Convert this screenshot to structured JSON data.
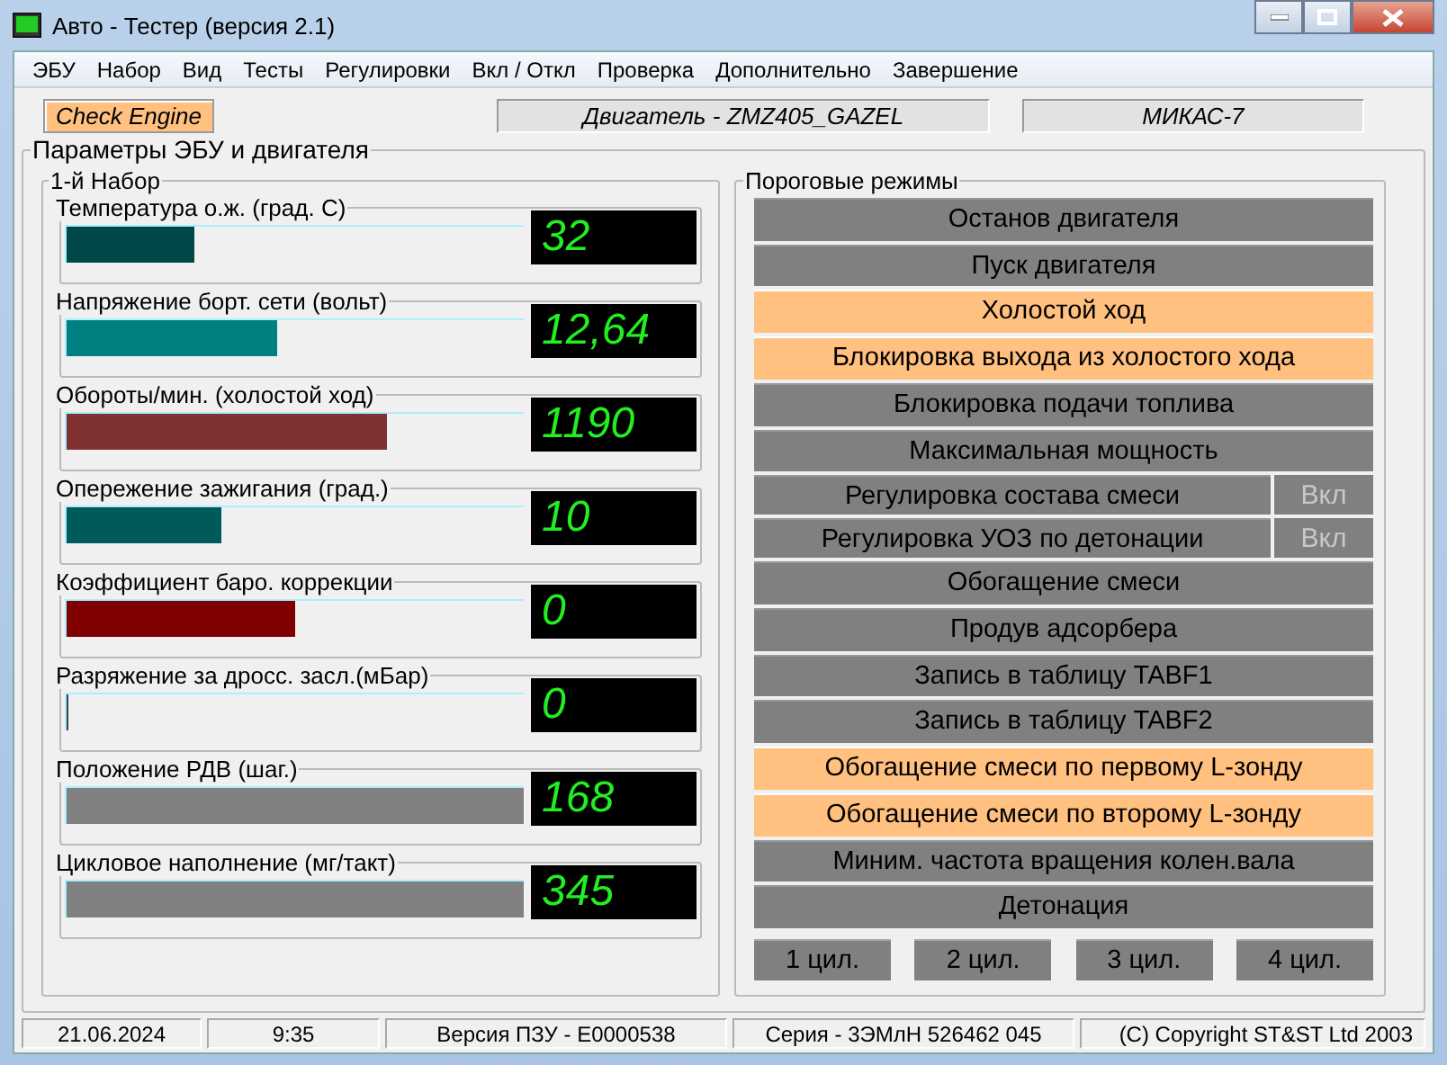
{
  "window": {
    "title": "Авто - Тестер  (версия 2.1)"
  },
  "menu": [
    "ЭБУ",
    "Набор",
    "Вид",
    "Тесты",
    "Регулировки",
    "Вкл / Откл",
    "Проверка",
    "Дополнительно",
    "Завершение"
  ],
  "header": {
    "check_engine": {
      "label": "Check Engine",
      "on": true
    },
    "engine": "Двигатель - ZMZ405_GAZEL",
    "ecu": "МИКАС-7"
  },
  "main_group": {
    "title": "Параметры ЭБУ и двигателя"
  },
  "set_group": {
    "title": "1-й  Набор",
    "gauges": [
      {
        "label": "Температура  о.ж. (град. С)",
        "level": 0.28,
        "color": "#004848",
        "value": "32"
      },
      {
        "label": "Напряжение борт. сети (вольт)",
        "level": 0.46,
        "color": "#008080",
        "value": "12,64"
      },
      {
        "label": "Обороты/мин. (холостой ход)",
        "level": 0.7,
        "color": "#803232",
        "value": "1190"
      },
      {
        "label": "Опережение зажигания (град.)",
        "level": 0.34,
        "color": "#005a5a",
        "value": "10"
      },
      {
        "label": "Коэффициент баро. коррекции",
        "level": 0.5,
        "color": "#800000",
        "value": "0"
      },
      {
        "label": "Разряжение за дросс. засл.(мБар)",
        "level": 0,
        "color": "#404040",
        "value": "0"
      },
      {
        "label": "Положение РДВ (шаг.)",
        "level": 1,
        "color": "#808080",
        "value": "168"
      },
      {
        "label": "Цикловое наполнение (мг/такт)",
        "level": 1,
        "color": "#808080",
        "value": "345"
      }
    ]
  },
  "modes_group": {
    "title": "Пороговые режимы",
    "modes": [
      {
        "kind": "mode",
        "label": "Останов двигателя",
        "active": false
      },
      {
        "kind": "mode",
        "label": "Пуск двигателя",
        "active": false
      },
      {
        "kind": "mode",
        "label": "Холостой ход",
        "active": true
      },
      {
        "kind": "mode",
        "label": "Блокировка выхода из холостого хода",
        "active": true
      },
      {
        "kind": "mode",
        "label": "Блокировка подачи топлива",
        "active": false
      },
      {
        "kind": "mode",
        "label": "Максимальная мощность",
        "active": false
      },
      {
        "kind": "toggle",
        "label": "Регулировка состава смеси",
        "active": false,
        "toggle": "Вкл",
        "toggle_on": false
      },
      {
        "kind": "toggle",
        "label": "Регулировка УОЗ по детонации",
        "active": false,
        "toggle": "Вкл",
        "toggle_on": false
      },
      {
        "kind": "mode",
        "label": "Обогащение смеси",
        "active": false
      },
      {
        "kind": "mode",
        "label": "Продув адсорбера",
        "active": false
      },
      {
        "kind": "mode",
        "label": "Запись в таблицу TABF1",
        "active": false
      },
      {
        "kind": "mode",
        "label": "Запись в таблицу TABF2",
        "active": false
      },
      {
        "kind": "mode",
        "label": "Обогащение смеси по первому L-зонду",
        "active": true
      },
      {
        "kind": "mode",
        "label": "Обогащение смеси по второму L-зонду",
        "active": true
      },
      {
        "kind": "mode",
        "label": "Миним. частота вращения колен.вала",
        "active": false
      },
      {
        "kind": "mode",
        "label": "Детонация",
        "active": false
      }
    ],
    "cylinders": [
      {
        "label": "1 цил.",
        "active": false
      },
      {
        "label": "2 цил.",
        "active": false
      },
      {
        "label": "3 цил.",
        "active": false
      },
      {
        "label": "4 цил.",
        "active": false
      }
    ]
  },
  "status_bar": [
    "21.06.2024",
    "9:35",
    "Версия ПЗУ - E0000538",
    "Серия - 3ЭМлН 526462 045",
    "(C) Copyright   ST&ST  Ltd 2003"
  ]
}
